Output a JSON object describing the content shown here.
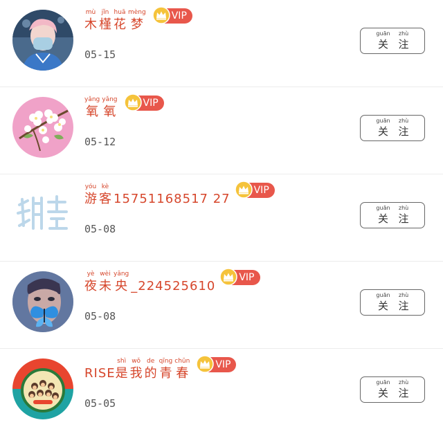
{
  "users": [
    {
      "name_chars": [
        {
          "py": "mù",
          "hz": "木"
        },
        {
          "py": "jǐn",
          "hz": "槿"
        },
        {
          "py": "huā",
          "hz": "花"
        },
        {
          "py": "mèng",
          "hz": "梦"
        }
      ],
      "name_suffix": "",
      "vip": "VIP",
      "date": "05-15",
      "avatar": "person-with-mask-avatar"
    },
    {
      "name_chars": [
        {
          "py": "yǎng",
          "hz": "氧"
        },
        {
          "py": "yǎng",
          "hz": "氧"
        }
      ],
      "name_suffix": "",
      "vip": "VIP",
      "date": "05-12",
      "avatar": "white-flowers-avatar"
    },
    {
      "name_chars": [
        {
          "py": "yóu",
          "hz": "游"
        },
        {
          "py": "kè",
          "hz": "客"
        }
      ],
      "name_suffix": "15751168517 27",
      "vip": "VIP",
      "date": "05-08",
      "avatar": "faded-text-avatar"
    },
    {
      "name_chars": [
        {
          "py": "yè",
          "hz": "夜"
        },
        {
          "py": "wèi",
          "hz": "未"
        },
        {
          "py": "yāng",
          "hz": "央"
        }
      ],
      "name_suffix": "_224525610",
      "vip": "VIP",
      "date": "05-08",
      "avatar": "butterfly-face-avatar"
    },
    {
      "name_prefix": "RISE",
      "name_chars": [
        {
          "py": "shì",
          "hz": "是"
        },
        {
          "py": "wǒ",
          "hz": "我"
        },
        {
          "py": "de",
          "hz": "的"
        },
        {
          "py": "qīng",
          "hz": "青"
        },
        {
          "py": "chūn",
          "hz": "春"
        }
      ],
      "name_suffix": "",
      "vip": "VIP",
      "date": "05-05",
      "avatar": "group-cartoon-avatar"
    }
  ],
  "follow_button": {
    "chars": [
      {
        "py": "guān",
        "hz": "关"
      },
      {
        "py": "zhù",
        "hz": "注"
      }
    ]
  },
  "colors": {
    "name": "#d6462b",
    "vip_badge": "#e8574b",
    "crown": "#f5c33b",
    "date": "#555555",
    "divider": "#ececec",
    "button_border": "#666666"
  }
}
